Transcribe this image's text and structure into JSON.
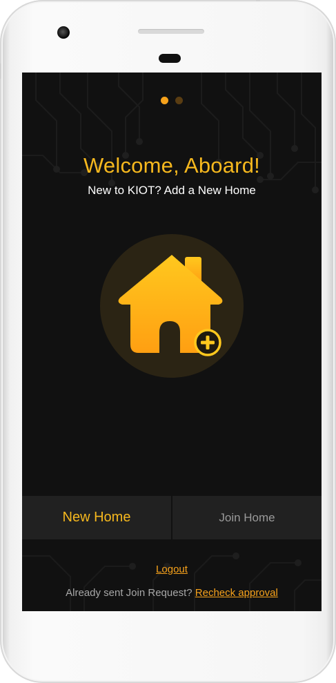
{
  "colors": {
    "accent": "#f6b81e",
    "link": "#f7a21b",
    "background": "#111111",
    "button_bg": "#212121",
    "house_circle": "#2b2414"
  },
  "pager": {
    "total": 2,
    "active_index": 0
  },
  "welcome": {
    "title": "Welcome, Aboard!",
    "subtitle": "New to KIOT? Add a New Home"
  },
  "illustration": {
    "icon": "house-add-icon"
  },
  "actions": {
    "new_home_label": "New Home",
    "join_home_label": "Join Home"
  },
  "footer": {
    "logout_label": "Logout",
    "join_request_text": "Already sent Join Request?",
    "recheck_label": "Recheck approval"
  }
}
